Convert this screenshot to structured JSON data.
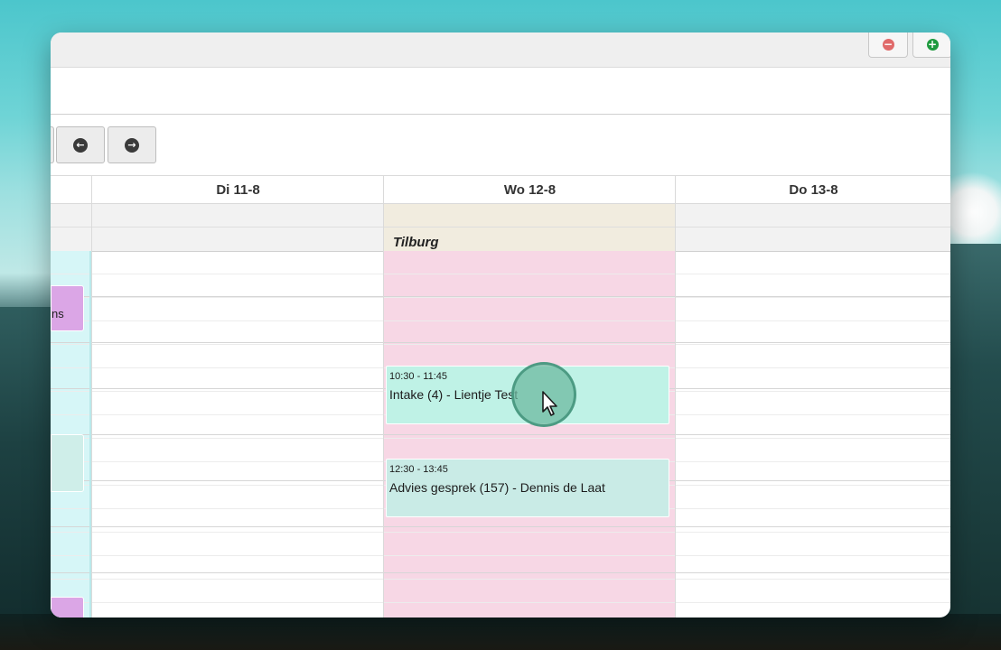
{
  "titlebar": {
    "minus_icon": "minus-circle-icon",
    "plus_icon": "plus-circle-icon",
    "colors": {
      "minus": "#e06a6a",
      "plus": "#1e9a3e"
    }
  },
  "nav": {
    "prev_icon": "arrow-left-circle-icon",
    "next_icon": "arrow-right-circle-icon"
  },
  "days": [
    {
      "label": "Di 11-8"
    },
    {
      "label": "Wo 12-8",
      "allday_label": "Tilburg"
    },
    {
      "label": "Do 13-8"
    }
  ],
  "side_events": [
    {
      "title_fragment": "ns",
      "color": "#dba6e6"
    },
    {
      "color": "#cfeee9"
    },
    {
      "color": "#dba6e6"
    }
  ],
  "events": [
    {
      "time": "10:30 - 11:45",
      "title": "Intake (4) - Lientje Test",
      "color": "#bff2e6"
    },
    {
      "time": "12:30 - 13:45",
      "title": "Advies gesprek (157) - Dennis de Laat",
      "color": "#c9ebe6"
    }
  ],
  "colors": {
    "highlight_day": "#f7d7e5",
    "today_column": "#d6f6f7",
    "allday_highlight": "#f1ecdf"
  }
}
